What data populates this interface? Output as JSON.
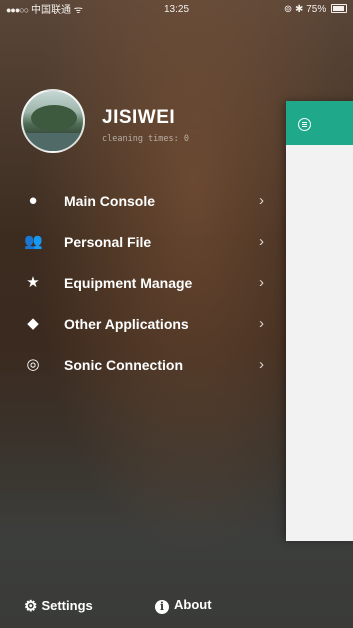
{
  "status_bar": {
    "signal": "●●●○○",
    "carrier": "中国联通",
    "wifi_icon": "ᯤ",
    "time": "13:25",
    "alarm_icon": "⊚",
    "bluetooth_icon": "✱",
    "battery": "75%"
  },
  "profile": {
    "name": "JISIWEI",
    "cleaning_times": "cleaning times: 0"
  },
  "menu": {
    "items": [
      {
        "label": "Main Console",
        "icon": "console-icon",
        "glyph": "●"
      },
      {
        "label": "Personal File",
        "icon": "person-icon",
        "glyph": "👥"
      },
      {
        "label": "Equipment Manage",
        "icon": "star-icon",
        "glyph": "★"
      },
      {
        "label": "Other Applications",
        "icon": "cube-icon",
        "glyph": "◆"
      },
      {
        "label": "Sonic Connection",
        "icon": "sonic-icon",
        "glyph": "◎"
      }
    ],
    "chevron": "›"
  },
  "footer": {
    "settings_label": "Settings",
    "about_label": "About",
    "settings_glyph": "⚙",
    "about_glyph": "i"
  },
  "colors": {
    "accent": "#1fa98a",
    "panel": "#f2f2f2"
  }
}
